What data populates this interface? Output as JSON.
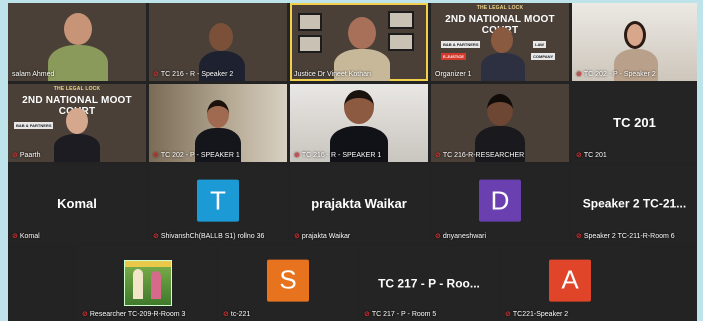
{
  "tiles": [
    {
      "name": "salam Ahmed",
      "type": "video",
      "muted": false
    },
    {
      "name": "TC 216 - R - Speaker 2",
      "type": "video",
      "muted": true
    },
    {
      "name": "Justice Dr Vineet Kothari",
      "type": "video",
      "muted": false
    },
    {
      "name": "Organizer 1",
      "type": "video",
      "muted": false
    },
    {
      "name": "TC 202 - P - Speaker 2",
      "type": "video",
      "muted": true
    },
    {
      "name": "Paarth",
      "type": "video",
      "muted": true
    },
    {
      "name": "TC 202 - P - SPEAKER 1",
      "type": "video",
      "muted": true
    },
    {
      "name": "TC 216 - R - SPEAKER 1",
      "type": "video",
      "muted": true
    },
    {
      "name": "TC 216-R-RESEARCHER",
      "type": "video",
      "muted": true
    },
    {
      "name": "TC 201",
      "display": "TC 201",
      "type": "name",
      "muted": true
    },
    {
      "name": "Komal",
      "display": "Komal",
      "type": "name",
      "muted": true
    },
    {
      "name": "ShivanshCh(BALLB S1) rollno 36",
      "letter": "T",
      "color": "#1c9ad6",
      "type": "avatar",
      "muted": true
    },
    {
      "name": "prajakta Waikar",
      "display": "prajakta Waikar",
      "type": "name",
      "muted": true
    },
    {
      "name": "dnyaneshwari",
      "letter": "D",
      "color": "#6a3fb0",
      "type": "avatar",
      "muted": true
    },
    {
      "name": "Speaker 2 TC-211-R-Room 6",
      "display": "Speaker 2 TC-21...",
      "type": "name",
      "muted": true
    },
    {
      "name": "Researcher TC-209-R-Room 3",
      "type": "photo",
      "muted": true
    },
    {
      "name": "tc-221",
      "letter": "S",
      "color": "#e8731e",
      "type": "avatar",
      "muted": true
    },
    {
      "name": "TC 217 - P - Room 5",
      "display": "TC 217 - P - Roo...",
      "type": "name",
      "muted": true
    },
    {
      "name": "TC221-Speaker 2",
      "letter": "A",
      "color": "#e0452a",
      "type": "avatar",
      "muted": true
    }
  ],
  "banner": {
    "header": "THE LEGAL LOCK",
    "title_line1": "2ND NATIONAL MOOT COURT",
    "title_line2": "COMPETITION 2023",
    "chip1": "B&B & PARTNERS",
    "chip2": "LAW",
    "chip3": "E-JUSTICE",
    "chip4": "COMPANY"
  },
  "colors": {
    "background": "#bfe3ea",
    "grid": "#232323",
    "mic_off": "#e33333"
  }
}
